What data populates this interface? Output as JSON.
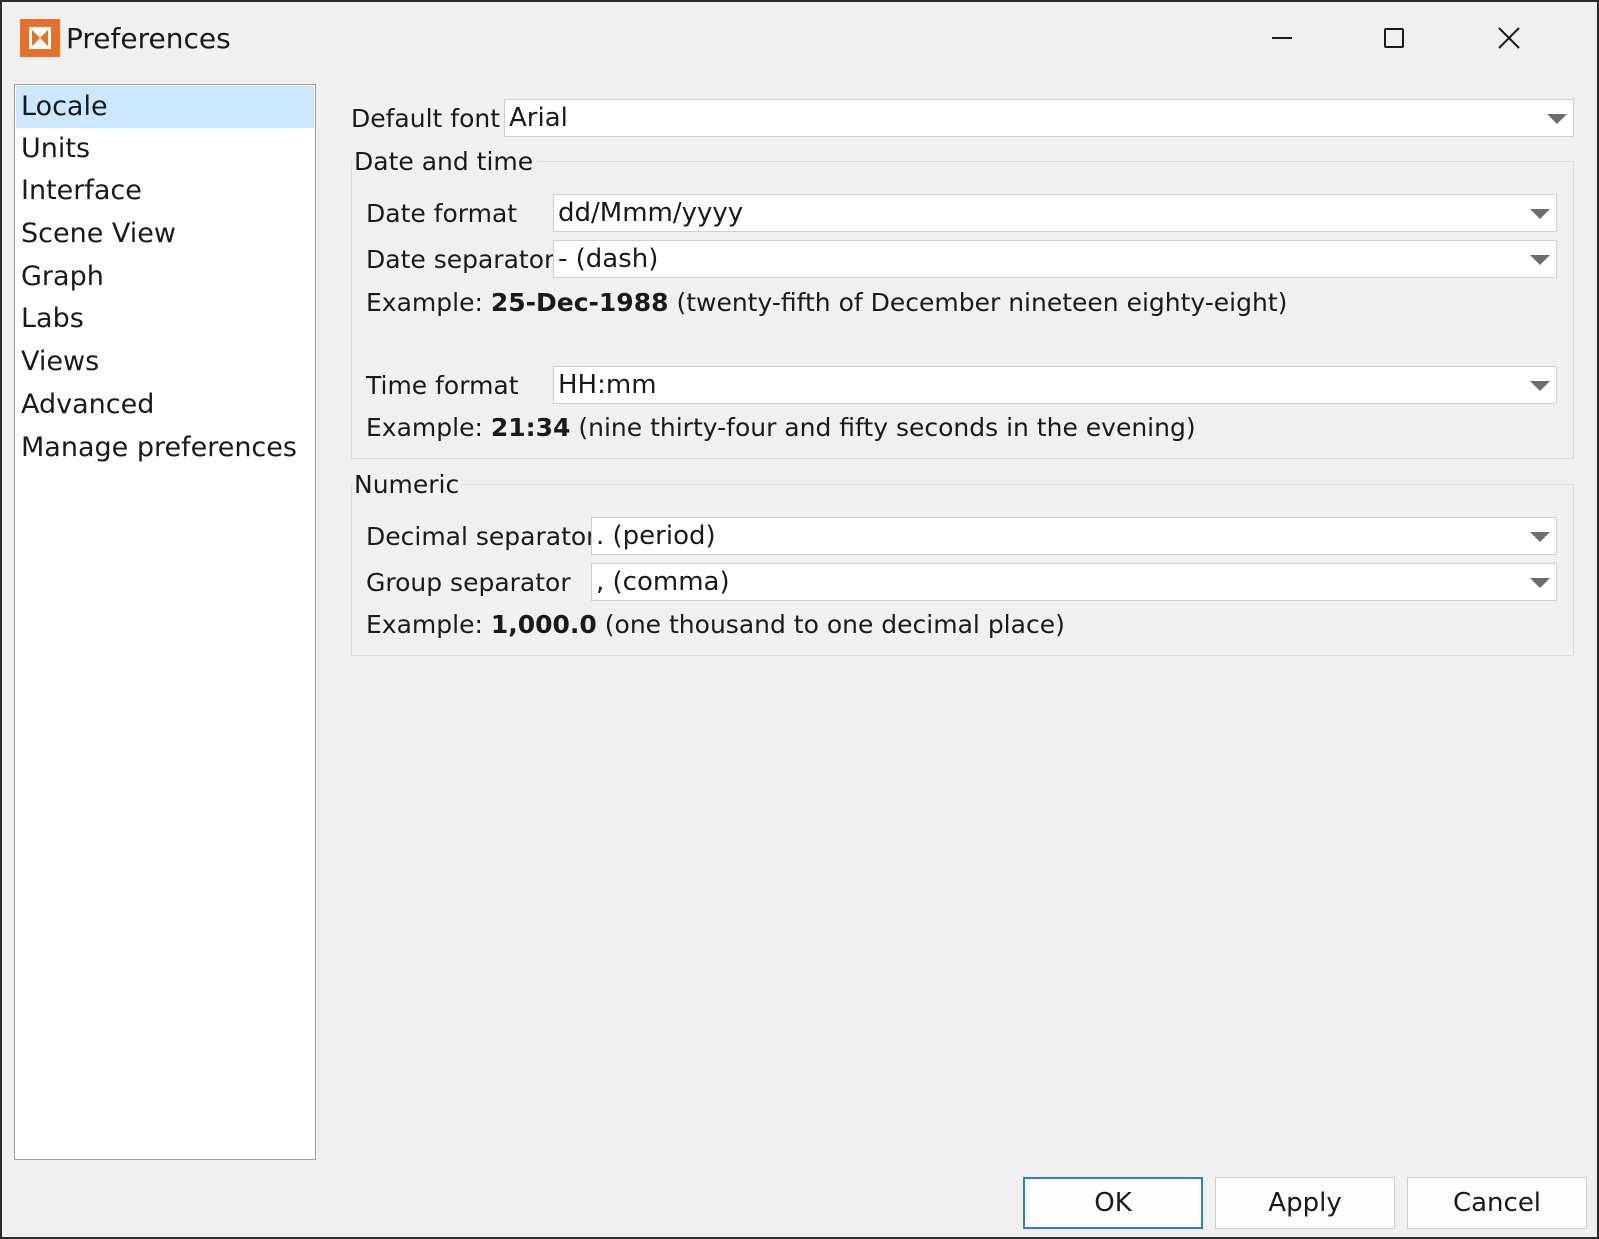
{
  "window": {
    "title": "Preferences",
    "icon": "app-logo-icon",
    "accent_color": "#e8712a"
  },
  "sidebar": {
    "items": [
      {
        "label": "Locale",
        "selected": true
      },
      {
        "label": "Units"
      },
      {
        "label": "Interface"
      },
      {
        "label": "Scene View"
      },
      {
        "label": "Graph"
      },
      {
        "label": "Labs"
      },
      {
        "label": "Views"
      },
      {
        "label": "Advanced"
      },
      {
        "label": "Manage preferences"
      }
    ],
    "selected_color": "#cce8ff"
  },
  "default_font": {
    "label": "Default font",
    "value": "Arial"
  },
  "date_time": {
    "title": "Date and time",
    "date_format_label": "Date format",
    "date_format_value": "dd/Mmm/yyyy",
    "date_separator_label": "Date separator",
    "date_separator_value": "- (dash)",
    "date_example_prefix": "Example:",
    "date_example_value": "25-Dec-1988",
    "date_example_text": "(twenty-fifth of December nineteen eighty-eight)",
    "time_format_label": "Time format",
    "time_format_value": "HH:mm",
    "time_example_prefix": "Example:",
    "time_example_value": "21:34",
    "time_example_text": "(nine thirty-four and fifty seconds in the evening)"
  },
  "numeric": {
    "title": "Numeric",
    "decimal_separator_label": "Decimal separator",
    "decimal_separator_value": ". (period)",
    "group_separator_label": "Group separator",
    "group_separator_value": ", (comma)",
    "example_prefix": "Example:",
    "example_value": "1,000.0",
    "example_text": "(one thousand to one decimal place)"
  },
  "buttons": {
    "ok": "OK",
    "apply": "Apply",
    "cancel": "Cancel"
  }
}
